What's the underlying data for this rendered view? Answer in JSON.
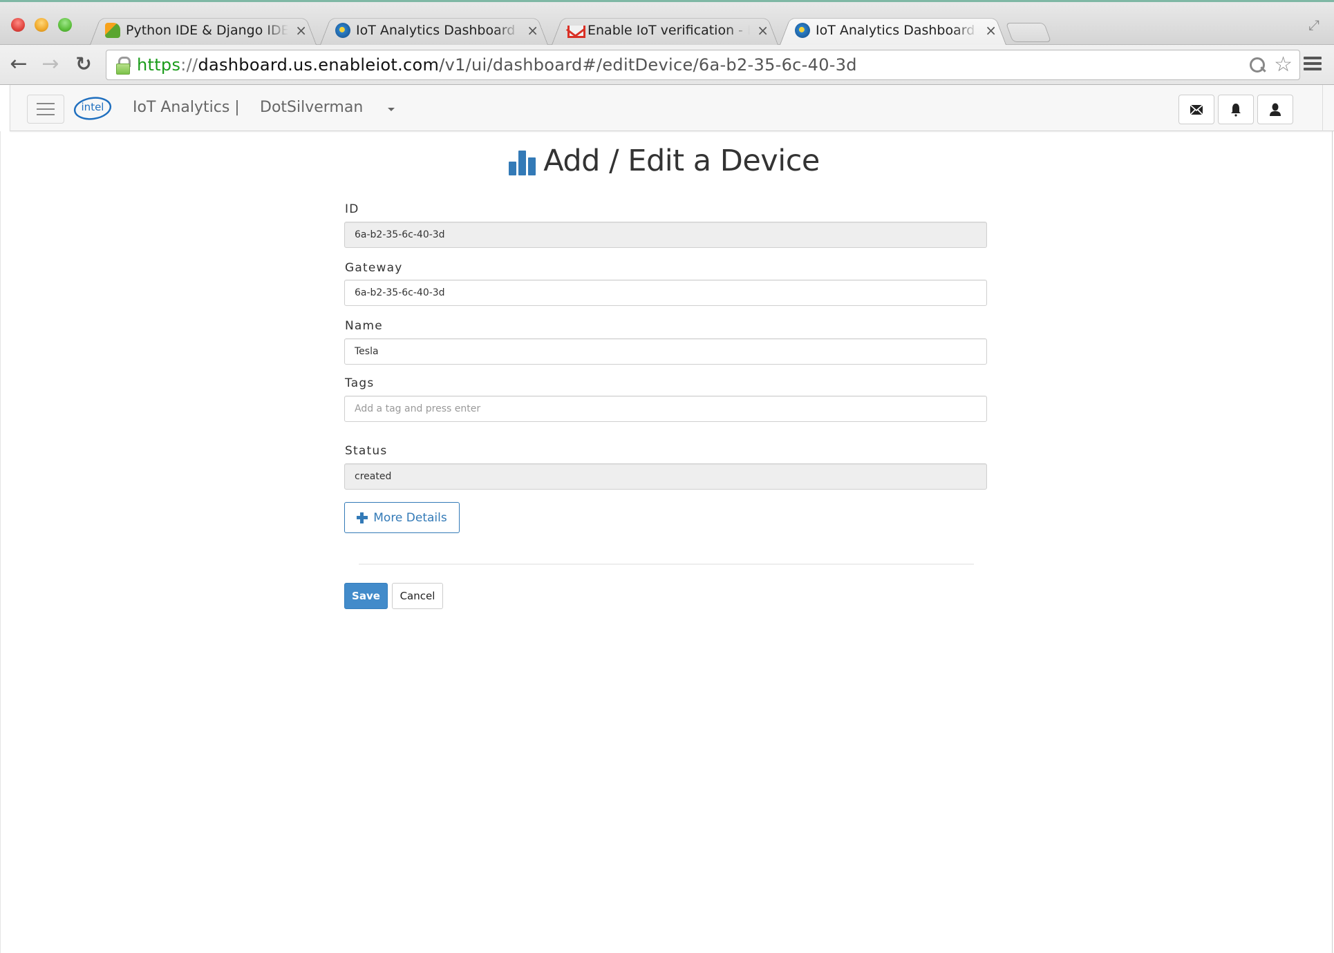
{
  "browser": {
    "tabs": [
      {
        "title": "Python IDE & Django IDE for Web developers",
        "favicon": "pycharm-icon",
        "active": false
      },
      {
        "title": "IoT Analytics Dashboard",
        "favicon": "iot-globe-icon",
        "active": false
      },
      {
        "title": "Enable IoT verification - Intel",
        "favicon": "gmail-icon",
        "active": false
      },
      {
        "title": "IoT Analytics Dashboard",
        "favicon": "iot-globe-icon",
        "active": true
      }
    ],
    "close_glyph": "×",
    "url": {
      "scheme": "https",
      "separator": "://",
      "host": "dashboard.us.enableiot.com",
      "path": "/v1/ui/dashboard#/editDevice/6a-b2-35-6c-40-3d"
    },
    "icons": {
      "back": "←",
      "forward": "→",
      "reload": "↻",
      "star": "☆",
      "fullscreen": "⤢"
    }
  },
  "app_nav": {
    "brand": "IoT Analytics |",
    "account": "DotSilverman",
    "logo_text": "intel"
  },
  "page": {
    "title": "Add / Edit a Device",
    "fields": {
      "id": {
        "label": "ID",
        "value": "6a-b2-35-6c-40-3d",
        "readonly": true
      },
      "gateway": {
        "label": "Gateway",
        "value": "6a-b2-35-6c-40-3d"
      },
      "name": {
        "label": "Name",
        "value": "Tesla"
      },
      "tags": {
        "label": "Tags",
        "value": "",
        "placeholder": "Add a tag and press enter"
      },
      "status": {
        "label": "Status",
        "value": "created",
        "readonly": true
      }
    },
    "more_details_label": "More Details",
    "save_label": "Save",
    "cancel_label": "Cancel"
  },
  "colors": {
    "primary": "#428bca",
    "link": "#337ab7",
    "https_green": "#1a9c1a"
  }
}
